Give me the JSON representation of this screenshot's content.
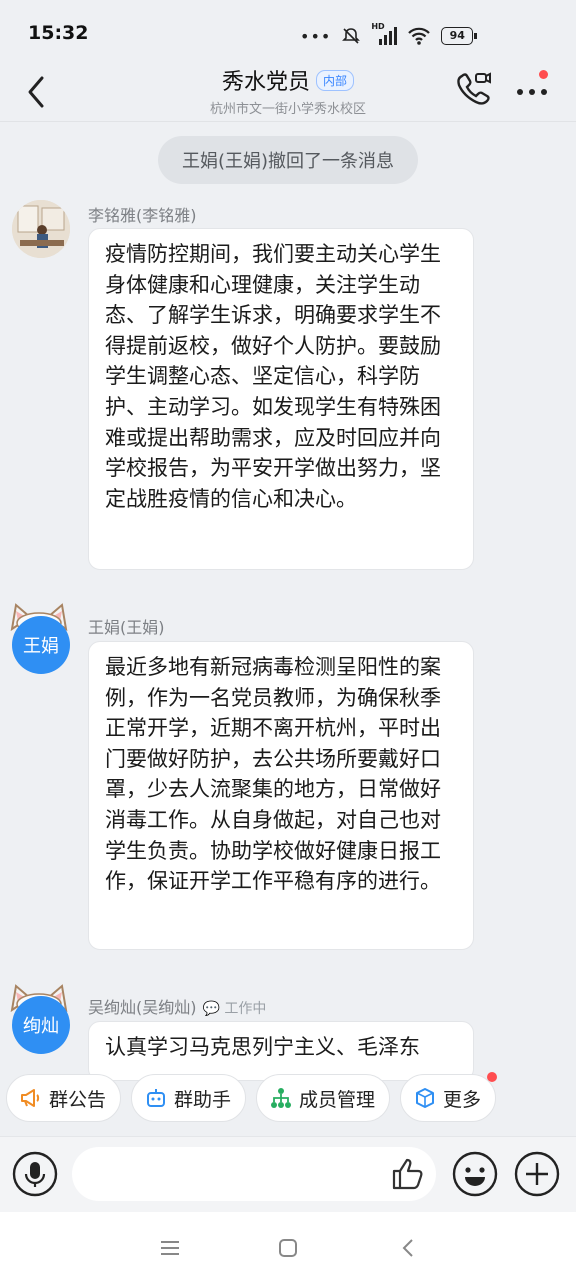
{
  "status_bar": {
    "time": "15:32",
    "network_label": "HD",
    "battery": "94"
  },
  "header": {
    "title": "秀水党员",
    "tag": "内部",
    "subtitle": "杭州市文一街小学秀水校区"
  },
  "system_message": "王娟(王娟)撤回了一条消息",
  "messages": [
    {
      "sender": "李铭雅(李铭雅)",
      "text": "疫情防控期间，我们要主动关心学生身体健康和心理健康，关注学生动态、了解学生诉求，明确要求学生不得提前返校，做好个人防护。要鼓励学生调整心态、坚定信心，科学防护、主动学习。如发现学生有特殊困难或提出帮助需求，应及时回应并向学校报告，为平安开学做出努力，坚定战胜疫情的信心和决心。"
    },
    {
      "sender": "王娟(王娟)",
      "avatar_text": "王娟",
      "text": "最近多地有新冠病毒检测呈阳性的案例，作为一名党员教师，为确保秋季正常开学，近期不离开杭州，平时出门要做好防护，去公共场所要戴好口罩，少去人流聚集的地方，日常做好消毒工作。从自身做起，对自己也对学生负责。协助学校做好健康日报工作，保证开学工作平稳有序的进行。"
    },
    {
      "sender": "吴绚灿(吴绚灿)",
      "status": "工作中",
      "avatar_text": "绚灿",
      "text": "认真学习马克思列宁主义、毛泽东"
    }
  ],
  "quick_actions": [
    {
      "label": "群公告",
      "icon": "megaphone-icon"
    },
    {
      "label": "群助手",
      "icon": "robot-icon"
    },
    {
      "label": "成员管理",
      "icon": "org-chart-icon"
    },
    {
      "label": "更多",
      "icon": "cube-icon"
    }
  ],
  "input": {
    "placeholder": ""
  },
  "colors": {
    "accent": "#2f8ff3",
    "badge": "#ff4d4f",
    "background": "#eef0f3"
  }
}
